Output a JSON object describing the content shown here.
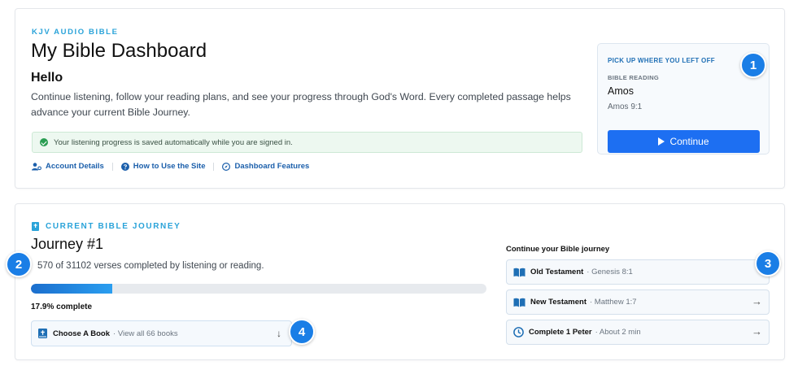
{
  "header": {
    "eyebrow": "KJV AUDIO BIBLE",
    "title": "My Bible Dashboard",
    "greeting": "Hello",
    "intro": "Continue listening, follow your reading plans, and see your progress through God's Word. Every completed passage helps advance your current Bible Journey."
  },
  "notice": {
    "text": "Your listening progress is saved automatically while you are signed in.",
    "icon": "check-circle-icon",
    "color": "#2a9d52"
  },
  "links": [
    {
      "label": "Account Details",
      "icon": "user-gear-icon"
    },
    {
      "label": "How to Use the Site",
      "icon": "question-circle-icon"
    },
    {
      "label": "Dashboard Features",
      "icon": "compass-icon"
    }
  ],
  "resume": {
    "eyebrow": "PICK UP WHERE YOU LEFT OFF",
    "label": "BIBLE READING",
    "book": "Amos",
    "reference": "Amos 9:1",
    "button_label": "Continue",
    "button_color": "#1d6ff2"
  },
  "journey": {
    "eyebrow": "CURRENT BIBLE JOURNEY",
    "title": "Journey #1",
    "verses_text": "570 of 31102 verses completed by listening or reading.",
    "progress_fraction": 0.179,
    "progress_label": "17.9% complete",
    "choose": {
      "label": "Choose A Book",
      "sub": "View all 66 books",
      "arrow": "↓"
    }
  },
  "continue_panel": {
    "title": "Continue your Bible journey",
    "items": [
      {
        "label": "Old Testament",
        "sub": "Genesis 8:1",
        "icon": "open-book-icon",
        "arrow": "→"
      },
      {
        "label": "New Testament",
        "sub": "Matthew 1:7",
        "icon": "open-book-icon",
        "arrow": "→"
      },
      {
        "label": "Complete 1 Peter",
        "sub": "About 2 min",
        "icon": "clock-icon",
        "arrow": "→"
      }
    ]
  },
  "badges": [
    "1",
    "2",
    "3",
    "4"
  ],
  "colors": {
    "accent": "#2aa3d9",
    "link": "#1b5fab",
    "badge": "#1a7ee6"
  }
}
